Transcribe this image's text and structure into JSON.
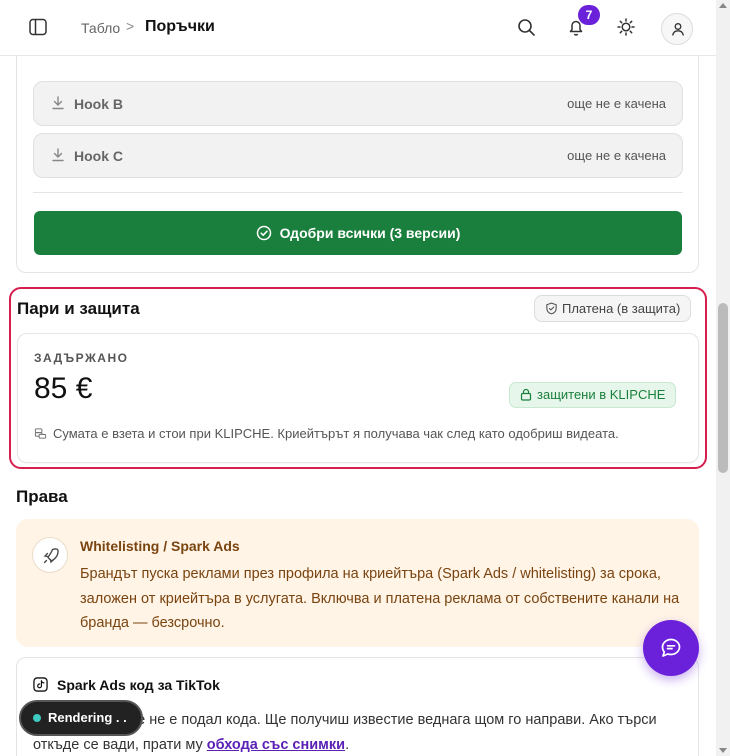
{
  "header": {
    "breadcrumb_parent": "Табло",
    "breadcrumb_separator": ">",
    "page_title": "Поръчки",
    "notification_count": "7"
  },
  "approval": {
    "hooks": [
      {
        "name": "Hook B",
        "status": "още не е качена"
      },
      {
        "name": "Hook C",
        "status": "още не е качена"
      }
    ],
    "approve_all_label": "Одобри всички (3 версии)"
  },
  "money": {
    "title": "Пари и защита",
    "paid_status": "Платена (в защита)",
    "held_label": "ЗАДЪРЖАНО",
    "held_amount": "85 €",
    "protected_label": "защитени в KLIPCHE",
    "note": "Сумата е взета и стои при KLIPCHE. Криейтърът я получава чак след като одобриш видеата."
  },
  "rights": {
    "title": "Права",
    "spark": {
      "title": "Whitelisting / Spark Ads",
      "description": "Брандът пуска реклами през профила на криейтъра (Spark Ads / whitelisting) за срока, заложен от криейтъра в услугата. Включва и платена реклама от собствените канали на бранда — безсрочно."
    },
    "tiktok": {
      "title": "Spark Ads код за TikTok",
      "text_before": "Криейтърът още не е подал кода. Ще получиш известие веднага щом го направи. Ако търси откъде се вади, прати му ",
      "link_label": "обхода със снимки",
      "text_after": "."
    }
  },
  "render_status": "Rendering . .",
  "colors": {
    "accent_purple": "#6b21d9",
    "approve_green": "#1a7f3c",
    "highlight_red": "#d61f4f",
    "spark_bg": "#fff4e6",
    "spark_text": "#7a4410"
  }
}
